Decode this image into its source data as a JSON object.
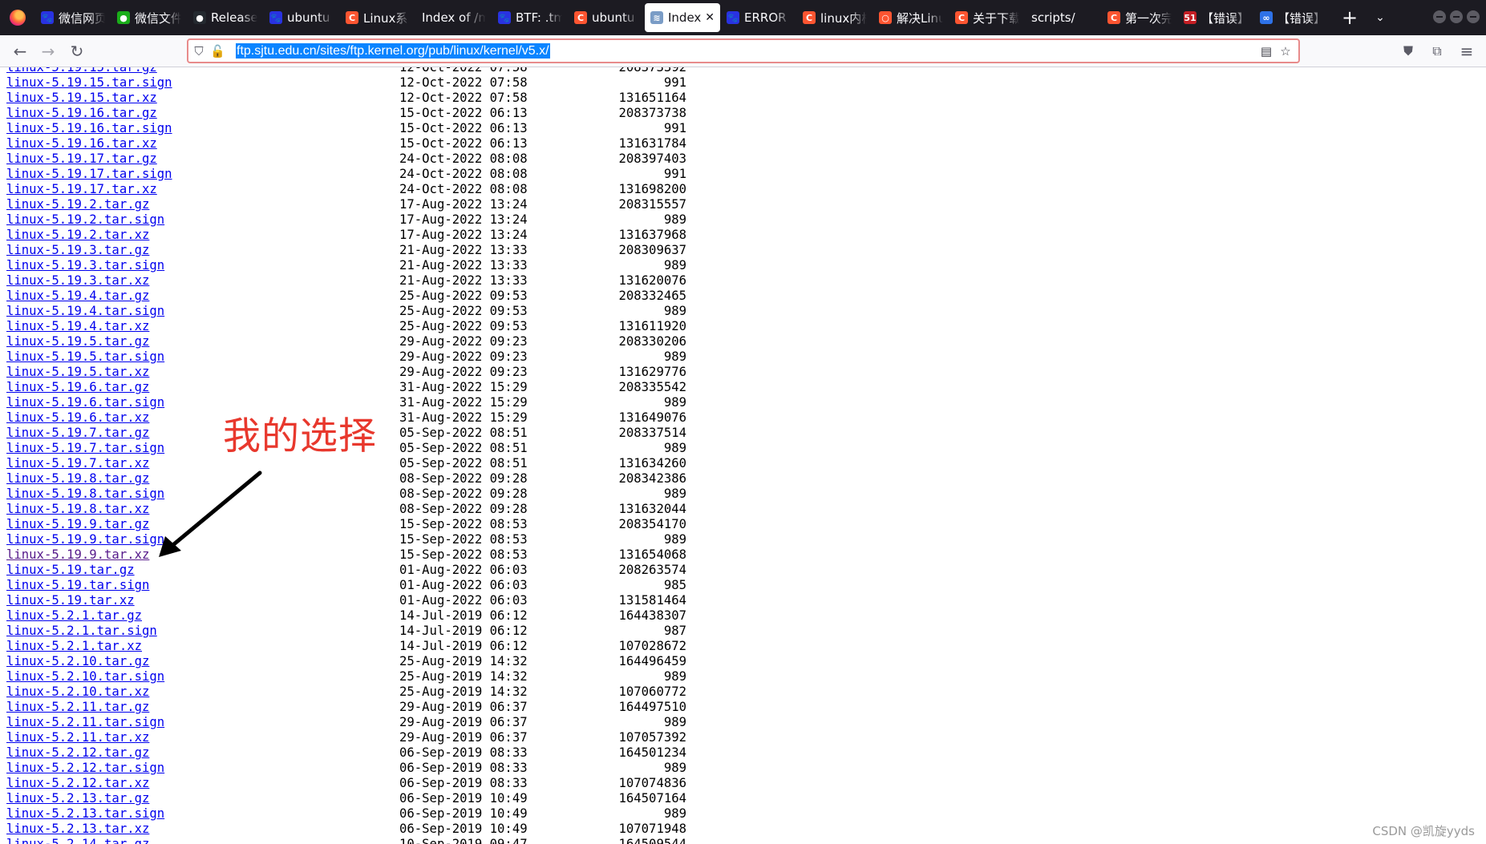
{
  "browser": {
    "tabs": [
      {
        "label": "微信网页",
        "favicon": "baidu-paw-icon",
        "fav_color": "#2932e1",
        "fav_text": "🐾",
        "active": false
      },
      {
        "label": "微信文件",
        "favicon": "wechat-icon",
        "fav_color": "#1aad19",
        "fav_text": "●",
        "active": false
      },
      {
        "label": "Releases",
        "favicon": "github-icon",
        "fav_color": "#24292f",
        "fav_text": "●",
        "active": false
      },
      {
        "label": "ubuntu",
        "favicon": "baidu-paw-icon",
        "fav_color": "#2932e1",
        "fav_text": "🐾",
        "active": false
      },
      {
        "label": "Linux系",
        "favicon": "csdn-icon",
        "fav_color": "#fc5531",
        "fav_text": "C",
        "active": false
      },
      {
        "label": "Index of /m",
        "favicon": "",
        "fav_color": "",
        "fav_text": "",
        "active": false
      },
      {
        "label": "BTF: .tm",
        "favicon": "baidu-paw-icon",
        "fav_color": "#2932e1",
        "fav_text": "🐾",
        "active": false
      },
      {
        "label": "ubuntu",
        "favicon": "csdn-icon",
        "fav_color": "#fc5531",
        "fav_text": "C",
        "active": false
      },
      {
        "label": "Index",
        "favicon": "sjtu-mirror-icon",
        "fav_color": "#7a9cc6",
        "fav_text": "≋",
        "active": true
      },
      {
        "label": "ERROR",
        "favicon": "baidu-paw-icon",
        "fav_color": "#2932e1",
        "fav_text": "🐾",
        "active": false
      },
      {
        "label": "linux内核",
        "favicon": "csdn-icon",
        "fav_color": "#fc5531",
        "fav_text": "C",
        "active": false
      },
      {
        "label": "解决Linux",
        "favicon": "csdn-ring-icon",
        "fav_color": "#fc5531",
        "fav_text": "○",
        "active": false
      },
      {
        "label": "关于下载",
        "favicon": "csdn-icon",
        "fav_color": "#fc5531",
        "fav_text": "C",
        "active": false
      },
      {
        "label": "scripts/",
        "favicon": "",
        "fav_color": "",
        "fav_text": "",
        "active": false
      },
      {
        "label": "第一次完",
        "favicon": "csdn-icon",
        "fav_color": "#fc5531",
        "fav_text": "C",
        "active": false
      },
      {
        "label": "【错误】",
        "favicon": "51cto-icon",
        "fav_color": "#c41e24",
        "fav_text": "51",
        "active": false
      },
      {
        "label": "【错误】",
        "favicon": "infinity-icon",
        "fav_color": "#2e72e8",
        "fav_text": "∞",
        "active": false
      }
    ],
    "new_tab": "+",
    "tab_list": "⌄",
    "url": "ftp.sjtu.edu.cn/sites/ftp.kernel.org/pub/linux/kernel/v5.x/"
  },
  "listing": {
    "partial_top_row": {
      "name": "linux-5.19.15.tar.gz",
      "date": "12-Oct-2022 07:58",
      "size": "208373392"
    },
    "rows": [
      {
        "name": "linux-5.19.15.tar.sign",
        "date": "12-Oct-2022 07:58",
        "size": "991",
        "visited": false
      },
      {
        "name": "linux-5.19.15.tar.xz",
        "date": "12-Oct-2022 07:58",
        "size": "131651164",
        "visited": false
      },
      {
        "name": "linux-5.19.16.tar.gz",
        "date": "15-Oct-2022 06:13",
        "size": "208373738",
        "visited": false
      },
      {
        "name": "linux-5.19.16.tar.sign",
        "date": "15-Oct-2022 06:13",
        "size": "991",
        "visited": false
      },
      {
        "name": "linux-5.19.16.tar.xz",
        "date": "15-Oct-2022 06:13",
        "size": "131631784",
        "visited": false
      },
      {
        "name": "linux-5.19.17.tar.gz",
        "date": "24-Oct-2022 08:08",
        "size": "208397403",
        "visited": false
      },
      {
        "name": "linux-5.19.17.tar.sign",
        "date": "24-Oct-2022 08:08",
        "size": "991",
        "visited": false
      },
      {
        "name": "linux-5.19.17.tar.xz",
        "date": "24-Oct-2022 08:08",
        "size": "131698200",
        "visited": false
      },
      {
        "name": "linux-5.19.2.tar.gz",
        "date": "17-Aug-2022 13:24",
        "size": "208315557",
        "visited": false
      },
      {
        "name": "linux-5.19.2.tar.sign",
        "date": "17-Aug-2022 13:24",
        "size": "989",
        "visited": false
      },
      {
        "name": "linux-5.19.2.tar.xz",
        "date": "17-Aug-2022 13:24",
        "size": "131637968",
        "visited": false
      },
      {
        "name": "linux-5.19.3.tar.gz",
        "date": "21-Aug-2022 13:33",
        "size": "208309637",
        "visited": false
      },
      {
        "name": "linux-5.19.3.tar.sign",
        "date": "21-Aug-2022 13:33",
        "size": "989",
        "visited": false
      },
      {
        "name": "linux-5.19.3.tar.xz",
        "date": "21-Aug-2022 13:33",
        "size": "131620076",
        "visited": false
      },
      {
        "name": "linux-5.19.4.tar.gz",
        "date": "25-Aug-2022 09:53",
        "size": "208332465",
        "visited": false
      },
      {
        "name": "linux-5.19.4.tar.sign",
        "date": "25-Aug-2022 09:53",
        "size": "989",
        "visited": false
      },
      {
        "name": "linux-5.19.4.tar.xz",
        "date": "25-Aug-2022 09:53",
        "size": "131611920",
        "visited": false
      },
      {
        "name": "linux-5.19.5.tar.gz",
        "date": "29-Aug-2022 09:23",
        "size": "208330206",
        "visited": false
      },
      {
        "name": "linux-5.19.5.tar.sign",
        "date": "29-Aug-2022 09:23",
        "size": "989",
        "visited": false
      },
      {
        "name": "linux-5.19.5.tar.xz",
        "date": "29-Aug-2022 09:23",
        "size": "131629776",
        "visited": false
      },
      {
        "name": "linux-5.19.6.tar.gz",
        "date": "31-Aug-2022 15:29",
        "size": "208335542",
        "visited": false
      },
      {
        "name": "linux-5.19.6.tar.sign",
        "date": "31-Aug-2022 15:29",
        "size": "989",
        "visited": false
      },
      {
        "name": "linux-5.19.6.tar.xz",
        "date": "31-Aug-2022 15:29",
        "size": "131649076",
        "visited": false
      },
      {
        "name": "linux-5.19.7.tar.gz",
        "date": "05-Sep-2022 08:51",
        "size": "208337514",
        "visited": false
      },
      {
        "name": "linux-5.19.7.tar.sign",
        "date": "05-Sep-2022 08:51",
        "size": "989",
        "visited": false
      },
      {
        "name": "linux-5.19.7.tar.xz",
        "date": "05-Sep-2022 08:51",
        "size": "131634260",
        "visited": false
      },
      {
        "name": "linux-5.19.8.tar.gz",
        "date": "08-Sep-2022 09:28",
        "size": "208342386",
        "visited": false
      },
      {
        "name": "linux-5.19.8.tar.sign",
        "date": "08-Sep-2022 09:28",
        "size": "989",
        "visited": false
      },
      {
        "name": "linux-5.19.8.tar.xz",
        "date": "08-Sep-2022 09:28",
        "size": "131632044",
        "visited": false
      },
      {
        "name": "linux-5.19.9.tar.gz",
        "date": "15-Sep-2022 08:53",
        "size": "208354170",
        "visited": false
      },
      {
        "name": "linux-5.19.9.tar.sign",
        "date": "15-Sep-2022 08:53",
        "size": "989",
        "visited": false
      },
      {
        "name": "linux-5.19.9.tar.xz",
        "date": "15-Sep-2022 08:53",
        "size": "131654068",
        "visited": true
      },
      {
        "name": "linux-5.19.tar.gz",
        "date": "01-Aug-2022 06:03",
        "size": "208263574",
        "visited": false
      },
      {
        "name": "linux-5.19.tar.sign",
        "date": "01-Aug-2022 06:03",
        "size": "985",
        "visited": false
      },
      {
        "name": "linux-5.19.tar.xz",
        "date": "01-Aug-2022 06:03",
        "size": "131581464",
        "visited": false
      },
      {
        "name": "linux-5.2.1.tar.gz",
        "date": "14-Jul-2019 06:12",
        "size": "164438307",
        "visited": false
      },
      {
        "name": "linux-5.2.1.tar.sign",
        "date": "14-Jul-2019 06:12",
        "size": "987",
        "visited": false
      },
      {
        "name": "linux-5.2.1.tar.xz",
        "date": "14-Jul-2019 06:12",
        "size": "107028672",
        "visited": false
      },
      {
        "name": "linux-5.2.10.tar.gz",
        "date": "25-Aug-2019 14:32",
        "size": "164496459",
        "visited": false
      },
      {
        "name": "linux-5.2.10.tar.sign",
        "date": "25-Aug-2019 14:32",
        "size": "989",
        "visited": false
      },
      {
        "name": "linux-5.2.10.tar.xz",
        "date": "25-Aug-2019 14:32",
        "size": "107060772",
        "visited": false
      },
      {
        "name": "linux-5.2.11.tar.gz",
        "date": "29-Aug-2019 06:37",
        "size": "164497510",
        "visited": false
      },
      {
        "name": "linux-5.2.11.tar.sign",
        "date": "29-Aug-2019 06:37",
        "size": "989",
        "visited": false
      },
      {
        "name": "linux-5.2.11.tar.xz",
        "date": "29-Aug-2019 06:37",
        "size": "107057392",
        "visited": false
      },
      {
        "name": "linux-5.2.12.tar.gz",
        "date": "06-Sep-2019 08:33",
        "size": "164501234",
        "visited": false
      },
      {
        "name": "linux-5.2.12.tar.sign",
        "date": "06-Sep-2019 08:33",
        "size": "989",
        "visited": false
      },
      {
        "name": "linux-5.2.12.tar.xz",
        "date": "06-Sep-2019 08:33",
        "size": "107074836",
        "visited": false
      },
      {
        "name": "linux-5.2.13.tar.gz",
        "date": "06-Sep-2019 10:49",
        "size": "164507164",
        "visited": false
      },
      {
        "name": "linux-5.2.13.tar.sign",
        "date": "06-Sep-2019 10:49",
        "size": "989",
        "visited": false
      },
      {
        "name": "linux-5.2.13.tar.xz",
        "date": "06-Sep-2019 10:49",
        "size": "107071948",
        "visited": false
      }
    ],
    "partial_bottom_row": {
      "name": "linux-5.2.14.tar.gz",
      "date": "10-Sep-2019 09:47",
      "size": "164509544"
    }
  },
  "annotation": {
    "text": "我的选择",
    "color": "#e8382d"
  },
  "watermark": "CSDN @凯旋yyds"
}
